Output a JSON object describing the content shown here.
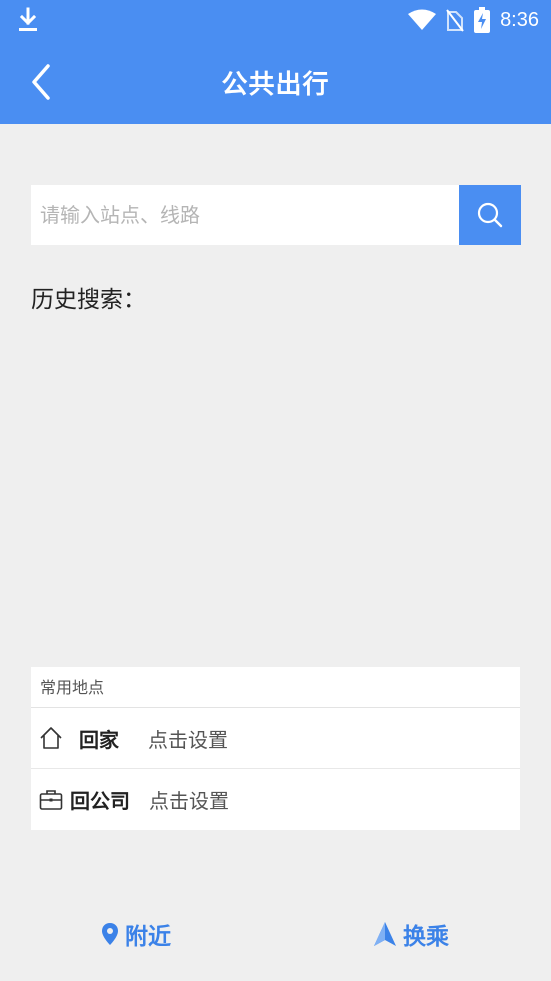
{
  "status_bar": {
    "time": "8:36",
    "icons": [
      "download-icon",
      "wifi-icon",
      "no-sim-icon",
      "battery-charging-icon"
    ]
  },
  "header": {
    "title": "公共出行",
    "back_icon": "chevron-left-icon"
  },
  "search": {
    "placeholder": "请输入站点、线路",
    "button_icon": "search-icon"
  },
  "history": {
    "title": "历史搜索："
  },
  "common_places": {
    "header": "常用地点",
    "items": [
      {
        "icon": "home-icon",
        "name": "回家",
        "action": "点击设置"
      },
      {
        "icon": "briefcase-icon",
        "name": "回公司",
        "action": "点击设置"
      }
    ]
  },
  "bottom_nav": {
    "nearby": {
      "icon": "location-pin-icon",
      "label": "附近"
    },
    "transfer": {
      "icon": "navigation-arrow-icon",
      "label": "换乘"
    }
  },
  "colors": {
    "primary": "#4a8ef2",
    "nav_text": "#3b82e8",
    "background": "#efefef"
  }
}
